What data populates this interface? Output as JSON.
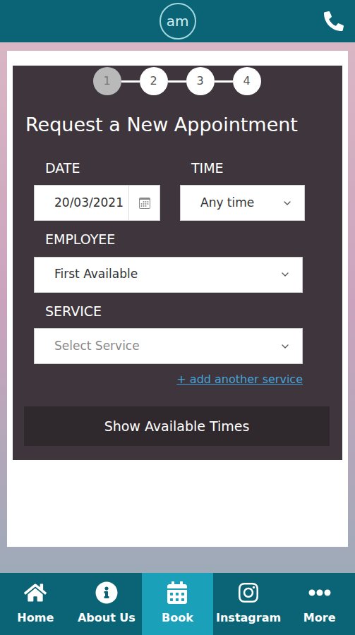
{
  "header": {
    "logo": "am"
  },
  "steps": [
    {
      "label": "1",
      "selected": true
    },
    {
      "label": "2",
      "selected": false
    },
    {
      "label": "3",
      "selected": false
    },
    {
      "label": "4",
      "selected": false
    }
  ],
  "form": {
    "title": "Request a New Appointment",
    "date": {
      "label": "DATE",
      "value": "20/03/2021"
    },
    "time": {
      "label": "TIME",
      "value": "Any time"
    },
    "employee": {
      "label": "EMPLOYEE",
      "value": "First Available"
    },
    "service": {
      "label": "SERVICE",
      "placeholder": "Select Service"
    },
    "add_link": "+ add another service",
    "submit": "Show Available Times"
  },
  "nav": [
    {
      "label": "Home",
      "selected": false
    },
    {
      "label": "About Us",
      "selected": false
    },
    {
      "label": "Book",
      "selected": true
    },
    {
      "label": "Instagram",
      "selected": false
    },
    {
      "label": "More",
      "selected": false
    }
  ]
}
